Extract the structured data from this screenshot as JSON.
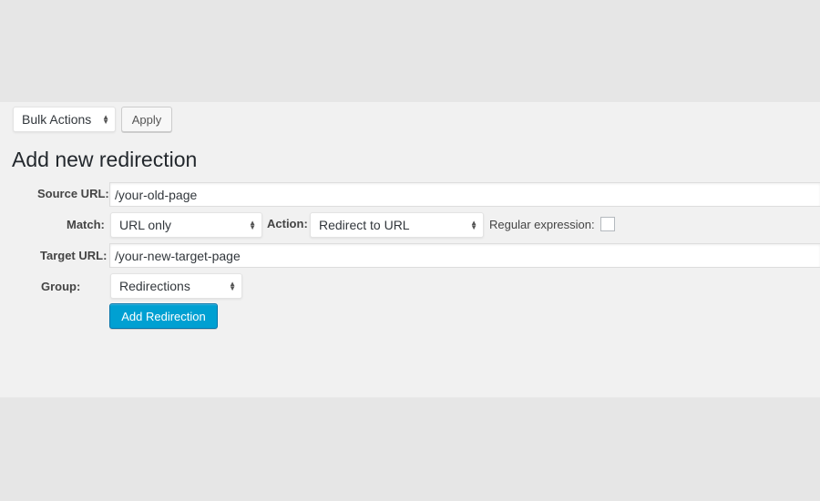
{
  "bulk_actions": {
    "select_value": "Bulk Actions",
    "apply_label": "Apply"
  },
  "form": {
    "title": "Add new redirection",
    "source_url": {
      "label": "Source URL:",
      "value": "/your-old-page"
    },
    "match": {
      "label": "Match:",
      "value": "URL only"
    },
    "action": {
      "label": "Action:",
      "value": "Redirect to URL"
    },
    "regex": {
      "label": "Regular expression:",
      "checked": false
    },
    "target_url": {
      "label": "Target URL:",
      "value": "/your-new-target-page"
    },
    "group": {
      "label": "Group:",
      "value": "Redirections"
    },
    "submit_label": "Add Redirection"
  },
  "icons": {
    "select_arrows": "up-down-arrows-icon",
    "arrow_up": "▲",
    "arrow_down": "▼"
  },
  "colors": {
    "primary_button": "#00a0d2",
    "panel_bg": "#f1f1f1",
    "page_bg": "#e6e6e6"
  }
}
